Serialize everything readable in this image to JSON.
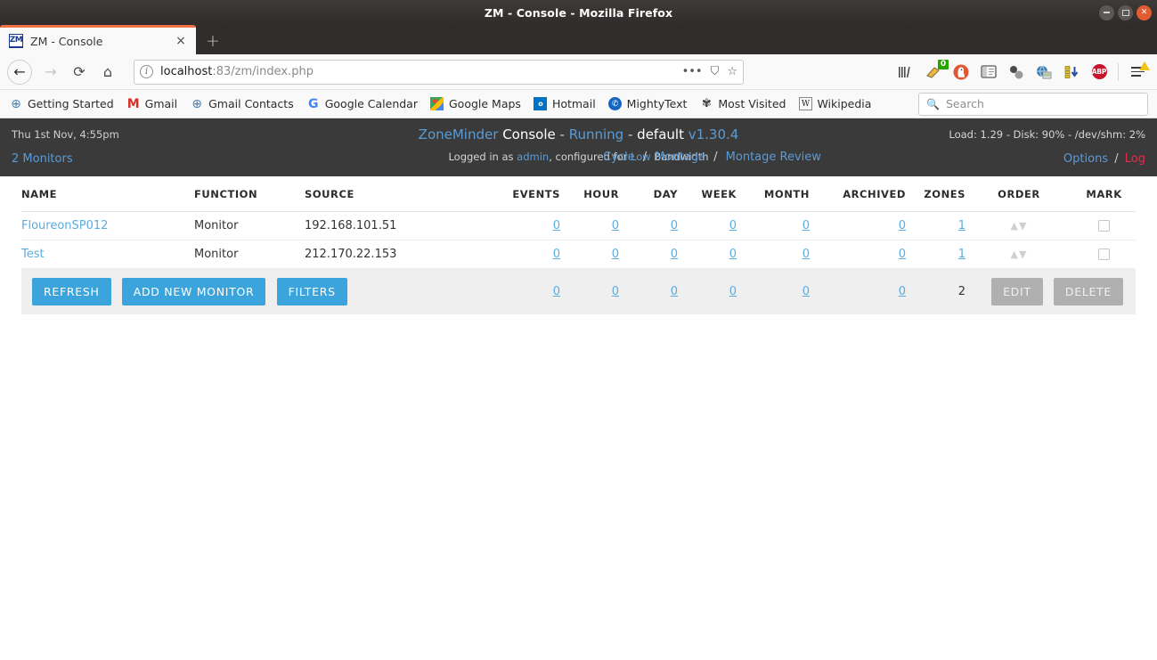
{
  "window": {
    "title": "ZM - Console - Mozilla Firefox",
    "minimize_label": "—",
    "maximize_label": "□",
    "close_label": "×"
  },
  "browser": {
    "tab": {
      "favicon_text": "ZM",
      "title": "ZM - Console",
      "close_label": "×"
    },
    "new_tab_label": "+",
    "nav": {
      "back_label": "←",
      "forward_label": "→",
      "reload_label": "⟳",
      "home_label": "⌂"
    },
    "url": {
      "host": "localhost",
      "rest": ":83/zm/index.php",
      "info_label": "i",
      "page_actions_label": "•••",
      "pocket_label": "⛉",
      "bookmark_label": "☆"
    },
    "toolbar_icons": [
      {
        "name": "library-icon",
        "glyph": "|||\\"
      },
      {
        "name": "pocket-save-icon",
        "glyph": "✎",
        "badge": "0"
      },
      {
        "name": "duckduckgo-icon",
        "glyph": "🦆"
      },
      {
        "name": "reader-sidebar-icon",
        "glyph": "▤"
      },
      {
        "name": "molecule-icon",
        "glyph": "⬤"
      },
      {
        "name": "globe-extension-icon",
        "glyph": "🌐"
      },
      {
        "name": "download-extension-icon",
        "glyph": "▤▼"
      },
      {
        "name": "adblock-plus-icon",
        "glyph": "ABP"
      }
    ],
    "menu_label": "☰",
    "bookmarks": [
      {
        "label": "Getting Started",
        "icon": "globe-icon"
      },
      {
        "label": "Gmail",
        "icon": "gmail-icon"
      },
      {
        "label": "Gmail Contacts",
        "icon": "globe-icon"
      },
      {
        "label": "Google Calendar",
        "icon": "google-icon"
      },
      {
        "label": "Google Maps",
        "icon": "google-maps-icon"
      },
      {
        "label": "Hotmail",
        "icon": "hotmail-icon"
      },
      {
        "label": "MightyText",
        "icon": "mightytext-icon"
      },
      {
        "label": "Most Visited",
        "icon": "gear-icon"
      },
      {
        "label": "Wikipedia",
        "icon": "wikipedia-icon"
      }
    ],
    "bookmark_search": {
      "placeholder": "Search",
      "icon": "search-icon"
    }
  },
  "zm": {
    "header": {
      "datetime": "Thu 1st Nov, 4:55pm",
      "monitors_link": "2 Monitors",
      "title": {
        "app": "ZoneMinder",
        "page": "Console",
        "dash1": "-",
        "state": "Running",
        "dash2": "-",
        "server": "default",
        "version": "v1.30.4"
      },
      "subtitle": {
        "logged_in_as": "Logged in as",
        "user": "admin",
        "configured_for": ", configured for",
        "bandwidth": "Low",
        "bandwidth_suffix": "Bandwidth"
      },
      "nav": [
        {
          "label": "Cycle"
        },
        {
          "label": "Montage"
        },
        {
          "label": "Montage Review"
        }
      ],
      "nav_separator": "/",
      "stats": "Load: 1.29 - Disk: 90% - /dev/shm: 2%",
      "options_link": "Options",
      "options_separator": "/",
      "log_link": "Log"
    },
    "table": {
      "columns": [
        "NAME",
        "FUNCTION",
        "SOURCE",
        "EVENTS",
        "HOUR",
        "DAY",
        "WEEK",
        "MONTH",
        "ARCHIVED",
        "ZONES",
        "ORDER",
        "MARK"
      ],
      "rows": [
        {
          "name": "FloureonSP012",
          "function": "Monitor",
          "source": "192.168.101.51",
          "events": "0",
          "hour": "0",
          "day": "0",
          "week": "0",
          "month": "0",
          "archived": "0",
          "zones": "1",
          "order": "▲▼",
          "mark_checked": false
        },
        {
          "name": "Test",
          "function": "Monitor",
          "source": "212.170.22.153",
          "events": "0",
          "hour": "0",
          "day": "0",
          "week": "0",
          "month": "0",
          "archived": "0",
          "zones": "1",
          "order": "▲▼",
          "mark_checked": false
        }
      ],
      "totals": {
        "events": "0",
        "hour": "0",
        "day": "0",
        "week": "0",
        "month": "0",
        "archived": "0",
        "zones": "2"
      },
      "buttons": {
        "refresh": "REFRESH",
        "add_new_monitor": "ADD NEW MONITOR",
        "filters": "FILTERS",
        "edit": "EDIT",
        "delete": "DELETE"
      }
    }
  },
  "colors": {
    "accent_blue": "#3ba4dd",
    "link_blue": "#5b9bd5",
    "source_red": "#d0103a",
    "function_olive": "#8a8a23",
    "log_red": "#e8294c",
    "header_bg": "#3a3a3a",
    "firefox_orange": "#ef7044"
  }
}
